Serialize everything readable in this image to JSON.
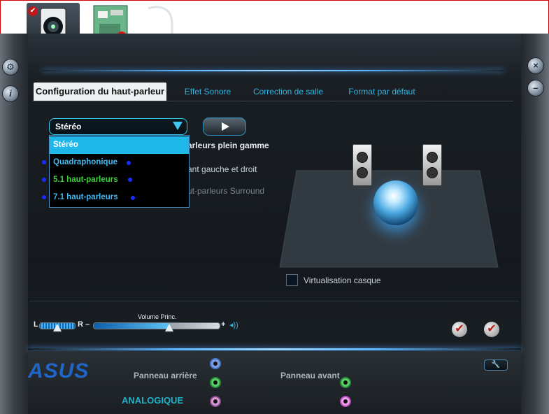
{
  "colors": {
    "accent": "#2fb3e0",
    "active_tab_bg": "#eef1f3",
    "brand": "#1f66c8",
    "window_bg": "#15191d"
  },
  "top_icons": [
    {
      "name": "speaker-device-icon",
      "active": true
    },
    {
      "name": "digital-output-icon",
      "active": false
    },
    {
      "name": "microphone-device-icon",
      "active": false
    }
  ],
  "tabs": [
    {
      "label": "Configuration du haut-parleur",
      "active": true
    },
    {
      "label": "Effet Sonore",
      "active": false
    },
    {
      "label": "Correction de salle",
      "active": false
    },
    {
      "label": "Format par défaut",
      "active": false
    }
  ],
  "speaker_config": {
    "selected": "Stéréo",
    "options": [
      "Stéréo",
      "Quadraphonique",
      "5.1 haut-parleurs",
      "7.1 haut-parleurs"
    ],
    "fullrange_label_partial": "arleurs plein gamme",
    "front_label_partial": "ant gauche et droit",
    "surround_label_partial": "ut-parleurs Surround",
    "headphone_virtualization": "Virtualisation casque",
    "headphone_virtualization_checked": false
  },
  "volume": {
    "balance_left": "L",
    "balance_right": "R",
    "label": "Volume Princ.",
    "minus": "–",
    "plus": "+",
    "level": 0.6,
    "balance": 0.5
  },
  "jacks": {
    "rear_label": "Panneau arrière",
    "front_label": "Panneau avant",
    "mode": "ANALOGIQUE",
    "brand": "ASUS"
  }
}
